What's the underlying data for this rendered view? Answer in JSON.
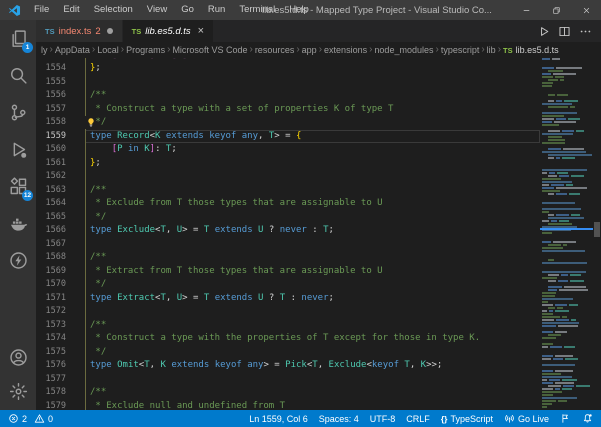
{
  "window": {
    "title": "lib.es5.d.ts - Mapped Type Project - Visual Studio Co...",
    "menu_items": [
      "File",
      "Edit",
      "Selection",
      "View",
      "Go",
      "Run",
      "Terminal",
      "Help"
    ],
    "controls": [
      {
        "name": "minimize",
        "icon": "minimize-icon"
      },
      {
        "name": "restore",
        "icon": "restore-icon"
      },
      {
        "name": "close",
        "icon": "close-icon"
      }
    ]
  },
  "activity_bar": {
    "top": [
      {
        "name": "explorer",
        "icon": "explorer-icon",
        "badge": "1"
      },
      {
        "name": "search",
        "icon": "search-icon"
      },
      {
        "name": "source-control",
        "icon": "source-control-icon"
      },
      {
        "name": "run-and-debug",
        "icon": "run-debug-icon"
      },
      {
        "name": "extensions",
        "icon": "extensions-icon",
        "badge": "12"
      },
      {
        "name": "docker",
        "icon": "docker-icon"
      },
      {
        "name": "thunder-client",
        "icon": "thunder-client-icon"
      }
    ],
    "bottom": [
      {
        "name": "accounts",
        "icon": "account-icon"
      },
      {
        "name": "settings",
        "icon": "settings-icon"
      }
    ]
  },
  "tabs": [
    {
      "name": "index.ts",
      "icon_text": "TS",
      "icon_color": "#519ABA",
      "label": "index.ts",
      "label_color": "#F48771",
      "badge": "2",
      "badge_color": "#F48771",
      "modified": true,
      "active": false,
      "italic": false
    },
    {
      "name": "lib.es5.d.ts",
      "icon_text": "TS",
      "icon_color": "#8DC149",
      "label": "lib.es5.d.ts",
      "label_color": "#FFFFFF",
      "active": true,
      "italic": true,
      "closable": true
    }
  ],
  "editor_actions": [
    {
      "name": "run",
      "icon": "run-icon"
    },
    {
      "name": "split-editor",
      "icon": "split-editor-icon"
    },
    {
      "name": "more-actions",
      "icon": "more-actions-icon"
    }
  ],
  "breadcrumb": {
    "items": [
      "ly",
      "AppData",
      "Local",
      "Programs",
      "Microsoft VS Code",
      "resources",
      "app",
      "extensions",
      "node_modules",
      "typescript",
      "lib"
    ],
    "file": {
      "icon_text": "TS",
      "icon_color": "#8DC149",
      "label": "lib.es5.d.ts"
    }
  },
  "colors": {
    "kw": "#569CD6",
    "type": "#4EC9B0",
    "comment": "#6A9955",
    "plain": "#D4D4D4",
    "brace": "#FFD700",
    "bracket": "#DA70D6",
    "accent": "#007ACC",
    "titlebar": "#3C3C3C",
    "activitybar": "#333333",
    "editor_bg": "#1E1E1E",
    "tab_inactive": "#2D2D2D"
  },
  "editor": {
    "current_line": 1559,
    "lines": [
      {
        "num": "",
        "partial": true,
        "tokens": [
          [
            "    ",
            "plain"
          ],
          [
            "[",
            "bracket"
          ],
          [
            "P",
            "type"
          ],
          [
            " ",
            "plain"
          ],
          [
            "in",
            "kw"
          ],
          [
            " ",
            "plain"
          ],
          [
            "K",
            "type"
          ],
          [
            "]",
            "bracket"
          ],
          [
            ": ",
            "plain"
          ],
          [
            "T",
            "type"
          ],
          [
            "[",
            "bracket"
          ],
          [
            "P",
            "type"
          ],
          [
            "]",
            "bracket"
          ],
          [
            ";",
            "plain"
          ]
        ]
      },
      {
        "num": 1554,
        "tokens": [
          [
            "}",
            "brace"
          ],
          [
            ";",
            "plain"
          ]
        ]
      },
      {
        "num": 1555,
        "tokens": []
      },
      {
        "num": 1556,
        "tokens": [
          [
            "/**",
            "comment"
          ]
        ]
      },
      {
        "num": 1557,
        "tokens": [
          [
            " * Construct a type with a set of properties K of type T",
            "comment"
          ]
        ]
      },
      {
        "num": 1558,
        "lightbulb": true,
        "tokens": [
          [
            " */",
            "comment"
          ]
        ]
      },
      {
        "num": 1559,
        "current": true,
        "tokens": [
          [
            "type",
            "kw"
          ],
          [
            " ",
            "plain"
          ],
          [
            "Record",
            "type"
          ],
          [
            "<",
            "plain"
          ],
          [
            "K",
            "type"
          ],
          [
            " ",
            "plain"
          ],
          [
            "extends",
            "kw"
          ],
          [
            " ",
            "plain"
          ],
          [
            "keyof",
            "kw"
          ],
          [
            " ",
            "plain"
          ],
          [
            "any",
            "kw"
          ],
          [
            ", ",
            "plain"
          ],
          [
            "T",
            "type"
          ],
          [
            "> = ",
            "plain"
          ],
          [
            "{",
            "brace"
          ]
        ]
      },
      {
        "num": 1560,
        "tokens": [
          [
            "    ",
            "plain"
          ],
          [
            "[",
            "bracket"
          ],
          [
            "P",
            "type"
          ],
          [
            " ",
            "plain"
          ],
          [
            "in",
            "kw"
          ],
          [
            " ",
            "plain"
          ],
          [
            "K",
            "type"
          ],
          [
            "]",
            "bracket"
          ],
          [
            ": ",
            "plain"
          ],
          [
            "T",
            "type"
          ],
          [
            ";",
            "plain"
          ]
        ]
      },
      {
        "num": 1561,
        "tokens": [
          [
            "}",
            "brace"
          ],
          [
            ";",
            "plain"
          ]
        ]
      },
      {
        "num": 1562,
        "tokens": []
      },
      {
        "num": 1563,
        "tokens": [
          [
            "/**",
            "comment"
          ]
        ]
      },
      {
        "num": 1564,
        "tokens": [
          [
            " * Exclude from T those types that are assignable to U",
            "comment"
          ]
        ]
      },
      {
        "num": 1565,
        "tokens": [
          [
            " */",
            "comment"
          ]
        ]
      },
      {
        "num": 1566,
        "tokens": [
          [
            "type",
            "kw"
          ],
          [
            " ",
            "plain"
          ],
          [
            "Exclude",
            "type"
          ],
          [
            "<",
            "plain"
          ],
          [
            "T",
            "type"
          ],
          [
            ", ",
            "plain"
          ],
          [
            "U",
            "type"
          ],
          [
            "> = ",
            "plain"
          ],
          [
            "T",
            "type"
          ],
          [
            " ",
            "plain"
          ],
          [
            "extends",
            "kw"
          ],
          [
            " ",
            "plain"
          ],
          [
            "U",
            "type"
          ],
          [
            " ? ",
            "plain"
          ],
          [
            "never",
            "kw"
          ],
          [
            " : ",
            "plain"
          ],
          [
            "T",
            "type"
          ],
          [
            ";",
            "plain"
          ]
        ]
      },
      {
        "num": 1567,
        "tokens": []
      },
      {
        "num": 1568,
        "tokens": [
          [
            "/**",
            "comment"
          ]
        ]
      },
      {
        "num": 1569,
        "tokens": [
          [
            " * Extract from T those types that are assignable to U",
            "comment"
          ]
        ]
      },
      {
        "num": 1570,
        "tokens": [
          [
            " */",
            "comment"
          ]
        ]
      },
      {
        "num": 1571,
        "tokens": [
          [
            "type",
            "kw"
          ],
          [
            " ",
            "plain"
          ],
          [
            "Extract",
            "type"
          ],
          [
            "<",
            "plain"
          ],
          [
            "T",
            "type"
          ],
          [
            ", ",
            "plain"
          ],
          [
            "U",
            "type"
          ],
          [
            "> = ",
            "plain"
          ],
          [
            "T",
            "type"
          ],
          [
            " ",
            "plain"
          ],
          [
            "extends",
            "kw"
          ],
          [
            " ",
            "plain"
          ],
          [
            "U",
            "type"
          ],
          [
            " ? ",
            "plain"
          ],
          [
            "T",
            "type"
          ],
          [
            " : ",
            "plain"
          ],
          [
            "never",
            "kw"
          ],
          [
            ";",
            "plain"
          ]
        ]
      },
      {
        "num": 1572,
        "tokens": []
      },
      {
        "num": 1573,
        "tokens": [
          [
            "/**",
            "comment"
          ]
        ]
      },
      {
        "num": 1574,
        "tokens": [
          [
            " * Construct a type with the properties of T except for those in type K.",
            "comment"
          ]
        ]
      },
      {
        "num": 1575,
        "tokens": [
          [
            " */",
            "comment"
          ]
        ]
      },
      {
        "num": 1576,
        "tokens": [
          [
            "type",
            "kw"
          ],
          [
            " ",
            "plain"
          ],
          [
            "Omit",
            "type"
          ],
          [
            "<",
            "plain"
          ],
          [
            "T",
            "type"
          ],
          [
            ", ",
            "plain"
          ],
          [
            "K",
            "type"
          ],
          [
            " ",
            "plain"
          ],
          [
            "extends",
            "kw"
          ],
          [
            " ",
            "plain"
          ],
          [
            "keyof",
            "kw"
          ],
          [
            " ",
            "plain"
          ],
          [
            "any",
            "kw"
          ],
          [
            "> = ",
            "plain"
          ],
          [
            "Pick",
            "type"
          ],
          [
            "<",
            "plain"
          ],
          [
            "T",
            "type"
          ],
          [
            ", ",
            "plain"
          ],
          [
            "Exclude",
            "type"
          ],
          [
            "<",
            "plain"
          ],
          [
            "keyof",
            "kw"
          ],
          [
            " ",
            "plain"
          ],
          [
            "T",
            "type"
          ],
          [
            ", ",
            "plain"
          ],
          [
            "K",
            "type"
          ],
          [
            ">>;",
            "plain"
          ]
        ]
      },
      {
        "num": 1577,
        "tokens": []
      },
      {
        "num": 1578,
        "tokens": [
          [
            "/**",
            "comment"
          ]
        ]
      },
      {
        "num": 1579,
        "tokens": [
          [
            " * Exclude null and undefined from T",
            "comment"
          ]
        ]
      }
    ]
  },
  "status_bar": {
    "left": [
      {
        "name": "errors",
        "icon": "error-icon",
        "label": "2"
      },
      {
        "name": "warnings",
        "icon": "warning-icon",
        "label": "0"
      }
    ],
    "right": [
      {
        "name": "cursor-position",
        "label": "Ln 1559, Col 6"
      },
      {
        "name": "indentation",
        "label": "Spaces: 4"
      },
      {
        "name": "encoding",
        "label": "UTF-8"
      },
      {
        "name": "eol",
        "label": "CRLF"
      },
      {
        "name": "language-mode",
        "icon": "braces-icon",
        "label": "TypeScript"
      },
      {
        "name": "go-live",
        "icon": "broadcast-icon",
        "label": "Go Live"
      },
      {
        "name": "flag",
        "icon": "flag-icon",
        "label": ""
      },
      {
        "name": "notifications",
        "icon": "bell-icon",
        "label": ""
      }
    ]
  }
}
